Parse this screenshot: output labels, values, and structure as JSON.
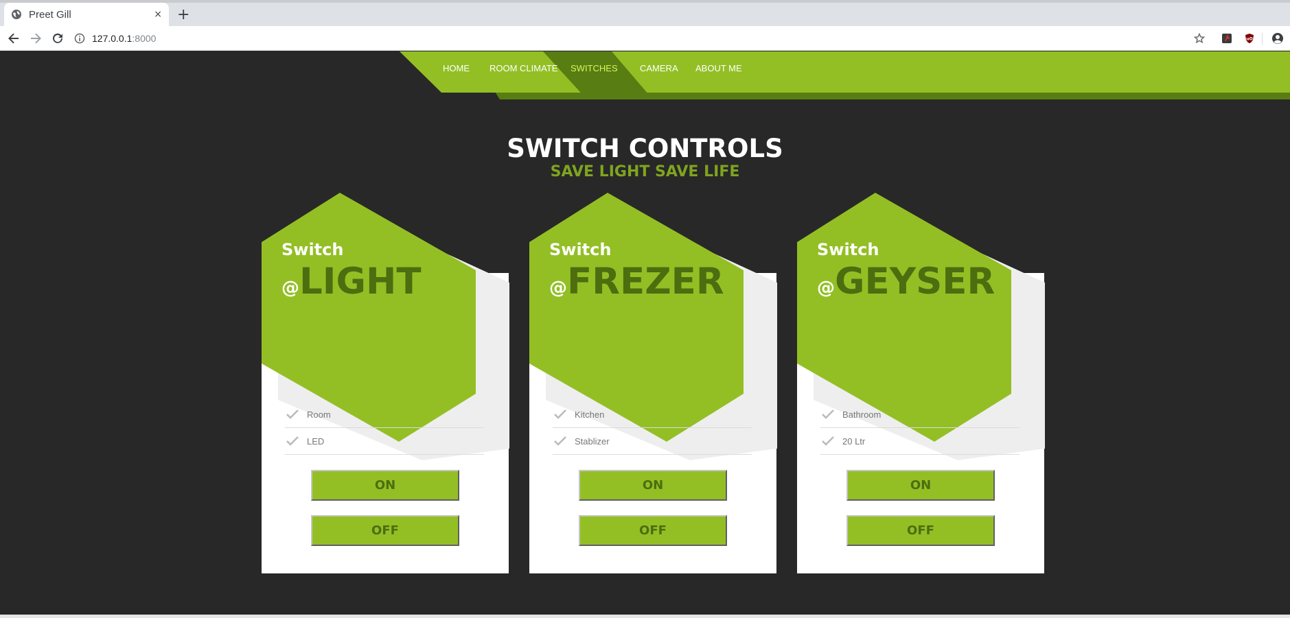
{
  "browser": {
    "tab_title": "Preet Gill",
    "tab_close": "×",
    "new_tab": "+",
    "url_host": "127.0.0.1",
    "url_port": ":8000"
  },
  "nav": {
    "items": [
      {
        "label": "HOME"
      },
      {
        "label": "ROOM CLIMATE"
      },
      {
        "label": "SWITCHES",
        "active": true
      },
      {
        "label": "CAMERA"
      },
      {
        "label": "ABOUT ME"
      }
    ]
  },
  "main": {
    "title": "SWITCH CONTROLS",
    "subtitle": "SAVE LIGHT SAVE LIFE"
  },
  "cards": [
    {
      "kicker": "Switch",
      "at": "@",
      "device": "LIGHT",
      "features": [
        "Room",
        "LED"
      ],
      "on_label": "ON",
      "off_label": "OFF"
    },
    {
      "kicker": "Switch",
      "at": "@",
      "device": "FREZER",
      "features": [
        "Kitchen",
        "Stablizer"
      ],
      "on_label": "ON",
      "off_label": "OFF"
    },
    {
      "kicker": "Switch",
      "at": "@",
      "device": "GEYSER",
      "features": [
        "Bathroom",
        "20 Ltr"
      ],
      "on_label": "ON",
      "off_label": "OFF"
    }
  ],
  "colors": {
    "accent": "#93bf25",
    "accent_dark": "#4d6d0f",
    "background": "#282828",
    "active_nav": "#d8f55a"
  },
  "icons": [
    "globe-icon",
    "back-icon",
    "forward-icon",
    "reload-icon",
    "info-icon",
    "star-icon",
    "extension-icon",
    "ublock-icon",
    "account-icon",
    "check-icon"
  ]
}
